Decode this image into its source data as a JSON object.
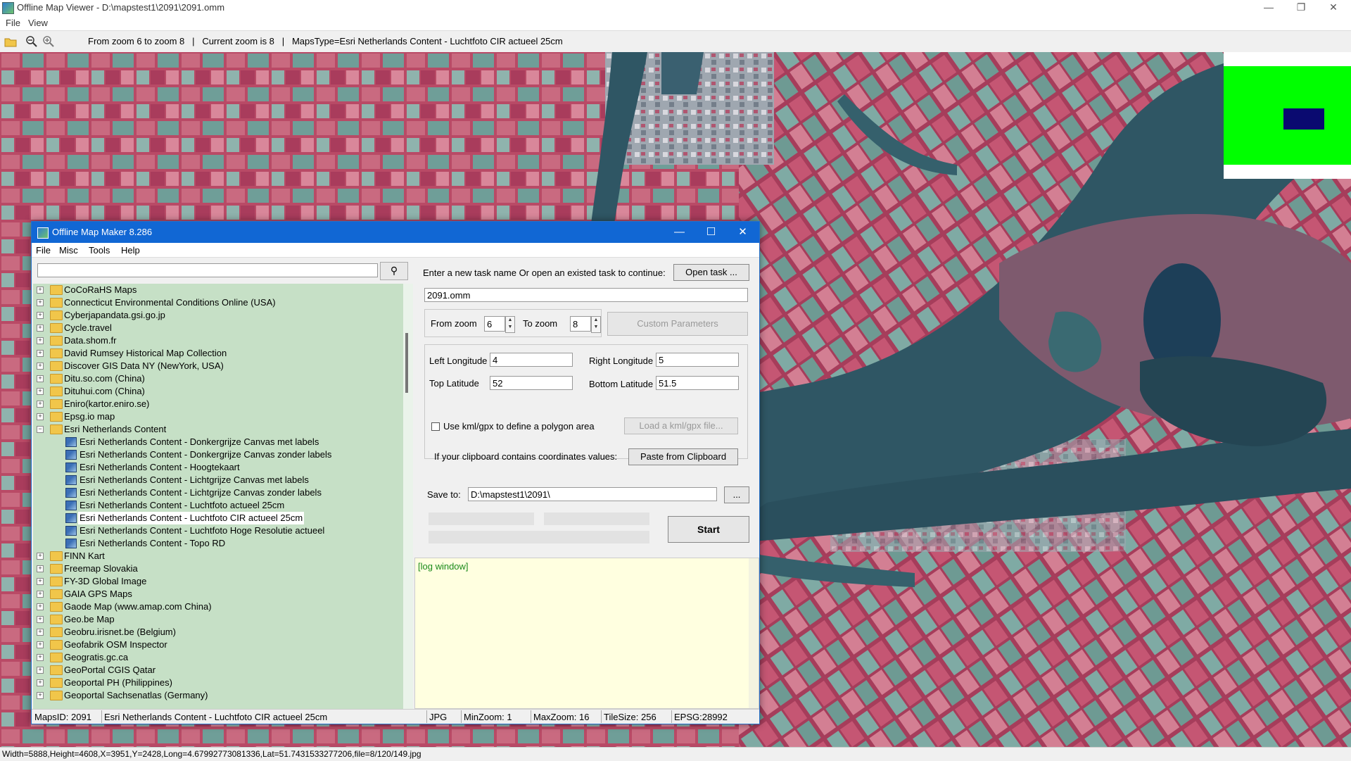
{
  "window": {
    "title": "Offline Map Viewer - D:\\mapstest1\\2091\\2091.omm"
  },
  "menu": [
    "File",
    "View"
  ],
  "toolbar": {
    "status": "From zoom 6 to zoom 8   |   Current zoom is 8   |   MapsType=Esri Netherlands Content - Luchtfoto CIR actueel 25cm"
  },
  "bottom_status": "Width=5888,Height=4608,X=3951,Y=2428,Long=4.67992773081336,Lat=51.7431533277206,file=8/120/149.jpg",
  "colors": {
    "overview_bg": "#00ff00",
    "overview_rect": "#0a0a70",
    "dialog_title": "#1167d4",
    "tree_bg": "#c6e0c6",
    "log_bg": "#ffffe0"
  },
  "dialog": {
    "title": "Offline Map Maker 8.286",
    "menu": [
      "File",
      "Misc",
      "Tools",
      "Help"
    ],
    "search_value": "",
    "tree": [
      {
        "label": "CoCoRaHS Maps",
        "type": "folder",
        "level": 0
      },
      {
        "label": "Connecticut Environmental Conditions Online (USA)",
        "type": "folder",
        "level": 0
      },
      {
        "label": "Cyberjapandata.gsi.go.jp",
        "type": "folder",
        "level": 0
      },
      {
        "label": "Cycle.travel",
        "type": "folder",
        "level": 0
      },
      {
        "label": "Data.shom.fr",
        "type": "folder",
        "level": 0
      },
      {
        "label": "David Rumsey Historical Map Collection",
        "type": "folder",
        "level": 0
      },
      {
        "label": "Discover GIS Data NY (NewYork, USA)",
        "type": "folder",
        "level": 0
      },
      {
        "label": "Ditu.so.com (China)",
        "type": "folder",
        "level": 0
      },
      {
        "label": "Dituhui.com (China)",
        "type": "folder",
        "level": 0
      },
      {
        "label": "Eniro(kartor.eniro.se)",
        "type": "folder",
        "level": 0
      },
      {
        "label": "Epsg.io map",
        "type": "folder",
        "level": 0
      },
      {
        "label": "Esri Netherlands Content",
        "type": "folder-open",
        "level": 0
      },
      {
        "label": "Esri Netherlands Content - Donkergrijze Canvas met labels",
        "type": "map",
        "level": 1
      },
      {
        "label": "Esri Netherlands Content - Donkergrijze Canvas zonder labels",
        "type": "map",
        "level": 1
      },
      {
        "label": "Esri Netherlands Content - Hoogtekaart",
        "type": "map",
        "level": 1
      },
      {
        "label": "Esri Netherlands Content - Lichtgrijze Canvas met labels",
        "type": "map",
        "level": 1
      },
      {
        "label": "Esri Netherlands Content - Lichtgrijze Canvas zonder labels",
        "type": "map",
        "level": 1
      },
      {
        "label": "Esri Netherlands Content - Luchtfoto actueel 25cm",
        "type": "map",
        "level": 1
      },
      {
        "label": "Esri Netherlands Content - Luchtfoto CIR actueel 25cm",
        "type": "map",
        "level": 1,
        "selected": true
      },
      {
        "label": "Esri Netherlands Content - Luchtfoto Hoge Resolutie actueel",
        "type": "map",
        "level": 1
      },
      {
        "label": "Esri Netherlands Content - Topo RD",
        "type": "map",
        "level": 1
      },
      {
        "label": "FINN Kart",
        "type": "folder",
        "level": 0
      },
      {
        "label": "Freemap Slovakia",
        "type": "folder",
        "level": 0
      },
      {
        "label": "FY-3D Global Image",
        "type": "folder",
        "level": 0
      },
      {
        "label": "GAIA GPS Maps",
        "type": "folder",
        "level": 0
      },
      {
        "label": "Gaode Map (www.amap.com China)",
        "type": "folder",
        "level": 0
      },
      {
        "label": "Geo.be Map",
        "type": "folder",
        "level": 0
      },
      {
        "label": "Geobru.irisnet.be (Belgium)",
        "type": "folder",
        "level": 0
      },
      {
        "label": "Geofabrik OSM Inspector",
        "type": "folder",
        "level": 0
      },
      {
        "label": "Geogratis.gc.ca",
        "type": "folder",
        "level": 0
      },
      {
        "label": "GeoPortal CGIS Qatar",
        "type": "folder",
        "level": 0
      },
      {
        "label": "Geoportal PH (Philippines)",
        "type": "folder",
        "level": 0
      },
      {
        "label": "Geoportal Sachsenatlas (Germany)",
        "type": "folder",
        "level": 0
      }
    ],
    "task_prompt": "Enter a new task name Or open an existed task to continue:",
    "open_task_label": "Open task ...",
    "task_name": "2091.omm",
    "from_zoom_label": "From zoom",
    "from_zoom": "6",
    "to_zoom_label": "To zoom",
    "to_zoom": "8",
    "custom_params_label": "Custom Parameters",
    "left_lon_label": "Left Longitude",
    "left_lon": "4",
    "right_lon_label": "Right Longitude",
    "right_lon": "5",
    "top_lat_label": "Top Latitude",
    "top_lat": "52",
    "bottom_lat_label": "Bottom Latitude",
    "bottom_lat": "51.5",
    "kml_label": "Use kml/gpx to define a polygon area",
    "load_kml_label": "Load a kml/gpx file...",
    "clipboard_prompt": "If your clipboard contains coordinates values:",
    "paste_label": "Paste from Clipboard",
    "save_to_label": "Save to:",
    "save_to": "D:\\mapstest1\\2091\\",
    "browse_label": "...",
    "start_label": "Start",
    "log_title": "[log window]",
    "status": {
      "maps_id": "MapsID: 2091",
      "map_name": "Esri Netherlands Content - Luchtfoto CIR actueel 25cm",
      "format": "JPG",
      "min_zoom": "MinZoom: 1",
      "max_zoom": "MaxZoom: 16",
      "tile_size": "TileSize: 256",
      "epsg": "EPSG:28992"
    }
  }
}
